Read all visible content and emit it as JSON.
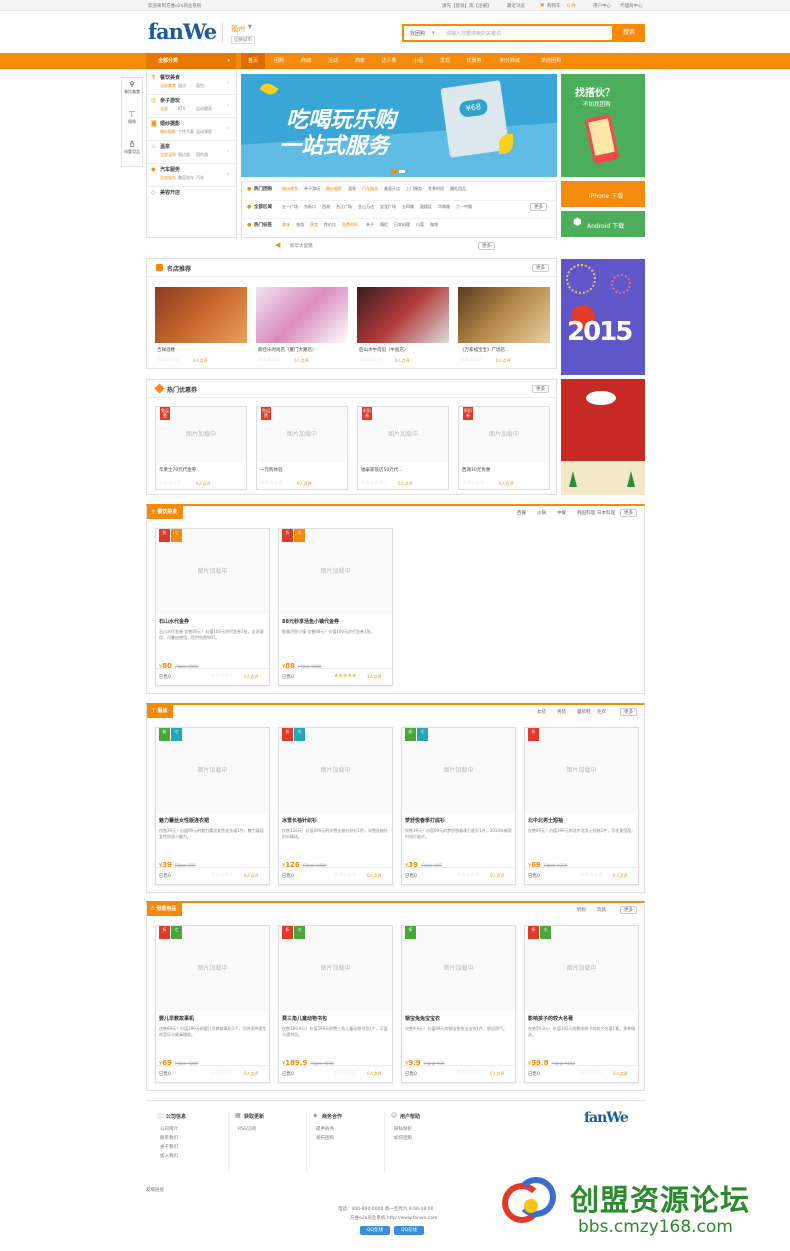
{
  "topbar": {
    "welcome": "欢迎来到方维o2o商业系统",
    "login": "请先【登录】或【注册】",
    "recent": "最近浏览",
    "cart": "购物车",
    "cart_count": "0 件",
    "user_center": "用户中心",
    "agent_center": "代理商中心"
  },
  "header": {
    "logo": "fanWe",
    "city": "福州",
    "switch_city": "切换城市",
    "search_type": "找团购",
    "search_placeholder": "请输入您要搜索的关键词",
    "search_button": "搜索"
  },
  "nav": {
    "all_cat": "全部分类",
    "items": [
      "首页",
      "团购",
      "商城",
      "活动",
      "商家",
      "达人秀",
      "小组",
      "发现",
      "优惠券",
      "积分商城",
      "单店团购"
    ]
  },
  "side_icons": [
    {
      "label": "餐饮美食"
    },
    {
      "label": "服装"
    },
    {
      "label": "母婴用品"
    }
  ],
  "categories": [
    {
      "name": "餐饮美食",
      "subs": [
        "全部美食",
        "甜点",
        "面包"
      ]
    },
    {
      "name": "亲子游玩",
      "subs": [
        "全部",
        "KTV",
        "运动健身"
      ]
    },
    {
      "name": "婚纱摄影",
      "subs": [
        "婚纱摄影",
        "个性写真",
        "运动课程"
      ]
    },
    {
      "name": "温泉",
      "subs": [
        "全部温泉",
        "周边游",
        "国内游"
      ]
    },
    {
      "name": "汽车服务",
      "subs": [
        "全部服务",
        "美容洗车",
        "汽车"
      ]
    },
    {
      "name": "美容开店",
      "subs": []
    }
  ],
  "banner": {
    "line1": "吃喝玩乐购",
    "line2": "一站式服务",
    "ticket": "¥68"
  },
  "side_promo": {
    "title": "找搭伙？",
    "sub": "不如找团购",
    "iphone": "iPhone 下载",
    "android": "Android 下载"
  },
  "hot_rows": [
    {
      "label": "热门团购",
      "tags": [
        "福州美食",
        "亲子游玩",
        "婚纱摄影",
        "温泉",
        "汽车服务",
        "美容开店",
        "上门服务",
        "冬季时尚",
        "婚礼用品"
      ]
    },
    {
      "label": "全部区域",
      "tags": [
        "五一广场",
        "东街口",
        "西湖",
        "台江广场",
        "仓山万达",
        "宝龙广场",
        "五四路",
        "鼓楼区",
        "华林路",
        "六一中路"
      ]
    },
    {
      "label": "热门标签",
      "tags": [
        "美味",
        "旅游",
        "便宜",
        "性价比",
        "免费WiFi",
        "亲子",
        "情侣",
        "日本料理",
        "川菜",
        "咖啡"
      ]
    }
  ],
  "more": "更多",
  "notice": "新年大促销",
  "famous": {
    "title": "名店推荐",
    "items": [
      {
        "name": "吉祥酒楼",
        "reviews": "0人点评"
      },
      {
        "name": "卿佳乐时尚店（厦门大路店）",
        "reviews": "0人点评"
      },
      {
        "name": "后山水牛肉馆（牛股店）",
        "reviews": "0人点评"
      },
      {
        "name": "《万家福宝宝》广场店...",
        "reviews": "0人点评"
      }
    ]
  },
  "coupons": {
    "title": "热门优惠券",
    "items": [
      {
        "badge": "免运费",
        "name": "华莱士70元代金券",
        "reviews": "0人点评"
      },
      {
        "badge": "免运费",
        "name": "一元购体验",
        "reviews": "0人点评"
      },
      {
        "badge": "折扣券",
        "name": "福泰家饭店50元代...",
        "reviews": "0人点评"
      },
      {
        "badge": "折扣券",
        "name": "西湖10元优惠",
        "reviews": "0人点评"
      }
    ]
  },
  "placeholder": "图片加载中",
  "section_food": {
    "title": "餐饮美食",
    "links": [
      "西餐",
      "火锅",
      "中餐",
      "韩国料理",
      "日本料理"
    ],
    "items": [
      {
        "title": "石山水代金券",
        "desc": "石山水代金券 仅售80元！价值100元的代金券1张，全场通用，可叠加使用，提供免费WiFi。",
        "price": "80",
        "orig": "门店价 ¥100",
        "sold": "已售0",
        "reviews": "0人点评",
        "rating": 0
      },
      {
        "title": "88元秒享活鱼小镇代金券",
        "desc": "鲜美活鱼小镇 仅售88元！价值100元的代金券1张。",
        "price": "88",
        "orig": "门店价 ¥100",
        "sold": "已售0",
        "reviews": "1人点评",
        "rating": 5
      }
    ]
  },
  "section_clothes": {
    "title": "服装",
    "links": [
      "女装",
      "男装",
      "童装鞋",
      "毛衣"
    ],
    "items": [
      {
        "title": "魅力蕾丝女性版连衣裙",
        "desc": "仅售39元！价值99元的魅力蕾丝女性连衣裙1件，魅力展现女性的迷人魅力。",
        "price": "39",
        "orig": "门店价 ¥99",
        "sold": "已售0",
        "reviews": "0人点评"
      },
      {
        "title": "冰雪长袖针织衫",
        "desc": "仅售126元！价值499元的冰雪长袖针织衫1件，冰雪长袖针织衫精选。",
        "price": "126",
        "orig": "门店价 ¥499",
        "sold": "已售0",
        "reviews": "0人点评"
      },
      {
        "title": "梦舒悦春季打底衫",
        "desc": "仅售39元！价值99元的梦舒悦春季打底衫1件，2014年新款时尚打底衫。",
        "price": "39",
        "orig": "门店价 ¥99",
        "sold": "已售0",
        "reviews": "0人点评"
      },
      {
        "title": "北中北男士短袖",
        "desc": "仅售69元！价值399元的北中北男士短袖1件，可任意搭配。",
        "price": "69",
        "orig": "门店价 ¥399",
        "sold": "已售0",
        "reviews": "0人点评"
      }
    ]
  },
  "section_baby": {
    "title": "母婴用品",
    "links": [
      "奶粉",
      "玩具"
    ],
    "items": [
      {
        "title": "婴儿早教故事机",
        "desc": "仅售69元！价值299元的婴儿早教故事机1个，可供多种类型的音乐与故事播放。",
        "price": "69",
        "orig": "门店价 ¥299",
        "sold": "已售0",
        "reviews": "0人点评"
      },
      {
        "title": "费三角儿童动物书包",
        "desc": "仅售189.9元！价值599元的费三角儿童动物书包1个，可爱卡通书包。",
        "price": "189.9",
        "orig": "门店价 ¥599",
        "sold": "已售0",
        "reviews": "0人点评"
      },
      {
        "title": "钢宝兔兔宝宝衣",
        "desc": "仅售9.9元！价值99元的钢宝兔兔宝宝衣1件，舒适透气。",
        "price": "9.9",
        "orig": "门店价 ¥99",
        "sold": "已售0",
        "reviews": "0人点评"
      },
      {
        "title": "影响孩子的较大名著",
        "desc": "仅售59.8元！价值102元的影响孩子的较大名著1套，多种精选。",
        "price": "59.8",
        "orig": "门店价 ¥102",
        "sold": "已售0",
        "reviews": "0人点评"
      }
    ]
  },
  "footer": {
    "cols": [
      {
        "title": "公司信息",
        "links": [
          "公司简介",
          "联系我们",
          "关于我们",
          "加入我们"
        ]
      },
      {
        "title": "获取更新",
        "links": [
          "RSS订阅"
        ]
      },
      {
        "title": "商务合作",
        "links": [
          "提供商务",
          "发布团购"
        ]
      },
      {
        "title": "用户帮助",
        "links": [
          "隐私保护",
          "如何团购"
        ]
      }
    ],
    "friend_links": "友情链接",
    "phone": "电话：400-800-0000 周一至周六 9:00-18:00",
    "copyright": "方维o2o商业系统 http://www.fanwe.com",
    "qq1": "QQ在线",
    "qq2": "QQ在线",
    "logo": "fanWe"
  },
  "watermark": {
    "text": "创盟资源论坛",
    "url": "bbs.cmzy168.com"
  }
}
